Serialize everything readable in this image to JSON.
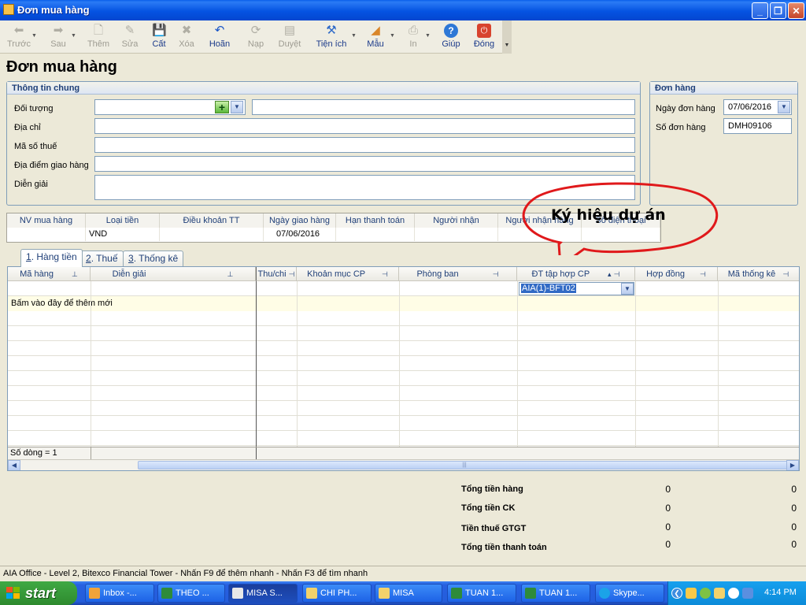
{
  "window": {
    "title": "Đơn mua hàng",
    "minimize": "_",
    "restore": "❐",
    "close": "✕"
  },
  "toolbar": {
    "items": [
      {
        "label": "Trước",
        "icon": "arrow-left-icon",
        "enabled": false
      },
      {
        "label": "Sau",
        "icon": "arrow-right-icon",
        "enabled": false
      },
      {
        "label": "Thêm",
        "icon": "add-document-icon",
        "enabled": false
      },
      {
        "label": "Sửa",
        "icon": "edit-icon",
        "enabled": false
      },
      {
        "label": "Cất",
        "icon": "save-icon",
        "enabled": true
      },
      {
        "label": "Xóa",
        "icon": "delete-icon",
        "enabled": false
      },
      {
        "label": "Hoãn",
        "icon": "undo-icon",
        "enabled": true
      },
      {
        "label": "Nạp",
        "icon": "reload-icon",
        "enabled": false
      },
      {
        "label": "Duyệt",
        "icon": "approve-icon",
        "enabled": false
      },
      {
        "label": "Tiện ích",
        "icon": "tools-icon",
        "enabled": true
      },
      {
        "label": "Mẫu",
        "icon": "template-icon",
        "enabled": true
      },
      {
        "label": "In",
        "icon": "print-icon",
        "enabled": false
      },
      {
        "label": "Giúp",
        "icon": "help-icon",
        "enabled": true
      },
      {
        "label": "Đóng",
        "icon": "close-power-icon",
        "enabled": true
      }
    ]
  },
  "form_title": "Đơn mua hàng",
  "general": {
    "header": "Thông tin chung",
    "doi_tuong_label": "Đối tượng",
    "doi_tuong_value": "",
    "doi_tuong_name_value": "",
    "dia_chi_label": "Địa chỉ",
    "dia_chi_value": "",
    "ma_so_thue_label": "Mã số thuế",
    "ma_so_thue_value": "",
    "dia_diem_label": "Địa điểm giao hàng",
    "dia_diem_value": "",
    "dien_giai_label": "Diễn giải",
    "dien_giai_value": ""
  },
  "order": {
    "header": "Đơn hàng",
    "ngay_label": "Ngày đơn hàng",
    "ngay_value": "07/06/2016",
    "so_label": "Số đơn hàng",
    "so_value": "DMH09106"
  },
  "info_strip": {
    "headers": [
      "NV mua hàng",
      "Loại tiền",
      "Điều khoản TT",
      "Ngày giao hàng",
      "Hạn thanh toán",
      "Người nhận",
      "Người nhận hàng",
      "Số điện thoại"
    ],
    "values": [
      "",
      "VND",
      "",
      "07/06/2016",
      "",
      "",
      "",
      ""
    ]
  },
  "tabs": [
    {
      "num": "1",
      "label": ". Hàng tiền"
    },
    {
      "num": "2",
      "label": ". Thuế"
    },
    {
      "num": "3",
      "label": ". Thống kê"
    }
  ],
  "grid": {
    "columns": [
      "Mã hàng",
      "Diễn giải",
      "Thu/chi",
      "Khoản mục CP",
      "Phòng ban",
      "ĐT tập hợp CP",
      "Hợp đồng",
      "Mã thống kê"
    ],
    "editor_value": "AIA(1)-BFT02",
    "add_row_text": "Bấm vào đây để thêm mới",
    "row_count": "Số dòng = 1"
  },
  "totals": [
    {
      "label": "Tổng tiền hàng",
      "v1": "0",
      "v2": "0"
    },
    {
      "label": "Tổng tiền CK",
      "v1": "0",
      "v2": "0"
    },
    {
      "label": "Tiền thuế GTGT",
      "v1": "0",
      "v2": "0"
    },
    {
      "label": "Tổng tiền thanh toán",
      "v1": "0",
      "v2": "0"
    }
  ],
  "annotation": "Ký hiệu dự án",
  "status_bar": "AIA Office - Level 2, Bitexco Financial Tower - Nhấn F9 để thêm nhanh - Nhấn F3 để tìm nhanh",
  "taskbar": {
    "start": "start",
    "tasks": [
      {
        "label": "Inbox -...",
        "color": "#F1A33A"
      },
      {
        "label": "THEO ...",
        "color": "#2E8B3A"
      },
      {
        "label": "MISA S...",
        "color": "#E8E8E8",
        "active": true
      },
      {
        "label": "CHI PH...",
        "color": "#F3D26B"
      },
      {
        "label": "MISA",
        "color": "#F3D26B"
      },
      {
        "label": "TUAN 1...",
        "color": "#2E8B3A"
      },
      {
        "label": "TUAN 1...",
        "color": "#2E8B3A"
      },
      {
        "label": "Skype...",
        "color": "#1BA3E8"
      }
    ],
    "clock": "4:14 PM"
  }
}
